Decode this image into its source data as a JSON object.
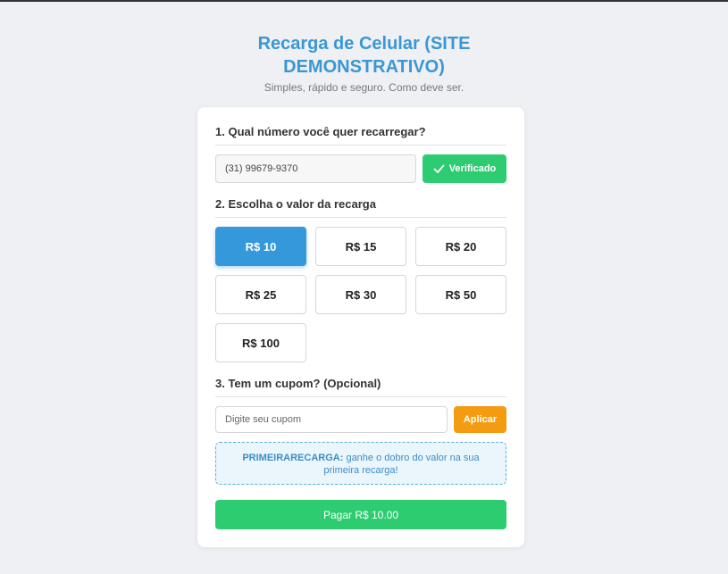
{
  "header": {
    "title": "Recarga de Celular (SITE DEMONSTRATIVO)",
    "subtitle": "Simples, rápido e seguro. Como deve ser."
  },
  "step1": {
    "title": "1. Qual número você quer recarregar?",
    "phone_value": "(31) 99679-9370",
    "verified_label": "Verificado",
    "verified_icon": "check-icon"
  },
  "step2": {
    "title": "2. Escolha o valor da recarga",
    "amounts": [
      "R$ 10",
      "R$ 15",
      "R$ 20",
      "R$ 25",
      "R$ 30",
      "R$ 50",
      "R$ 100"
    ],
    "selected_amount": "R$ 10"
  },
  "step3": {
    "title": "3. Tem um cupom? (Opcional)",
    "coupon_placeholder": "Digite seu cupom",
    "apply_label": "Aplicar",
    "promo_code": "PRIMEIRARECARGA:",
    "promo_text": " ganhe o dobro do valor na sua primeira recarga!"
  },
  "pay_label": "Pagar R$ 10.00",
  "colors": {
    "accent": "#3498db",
    "success": "#2ecc71",
    "warning": "#f39c12"
  }
}
